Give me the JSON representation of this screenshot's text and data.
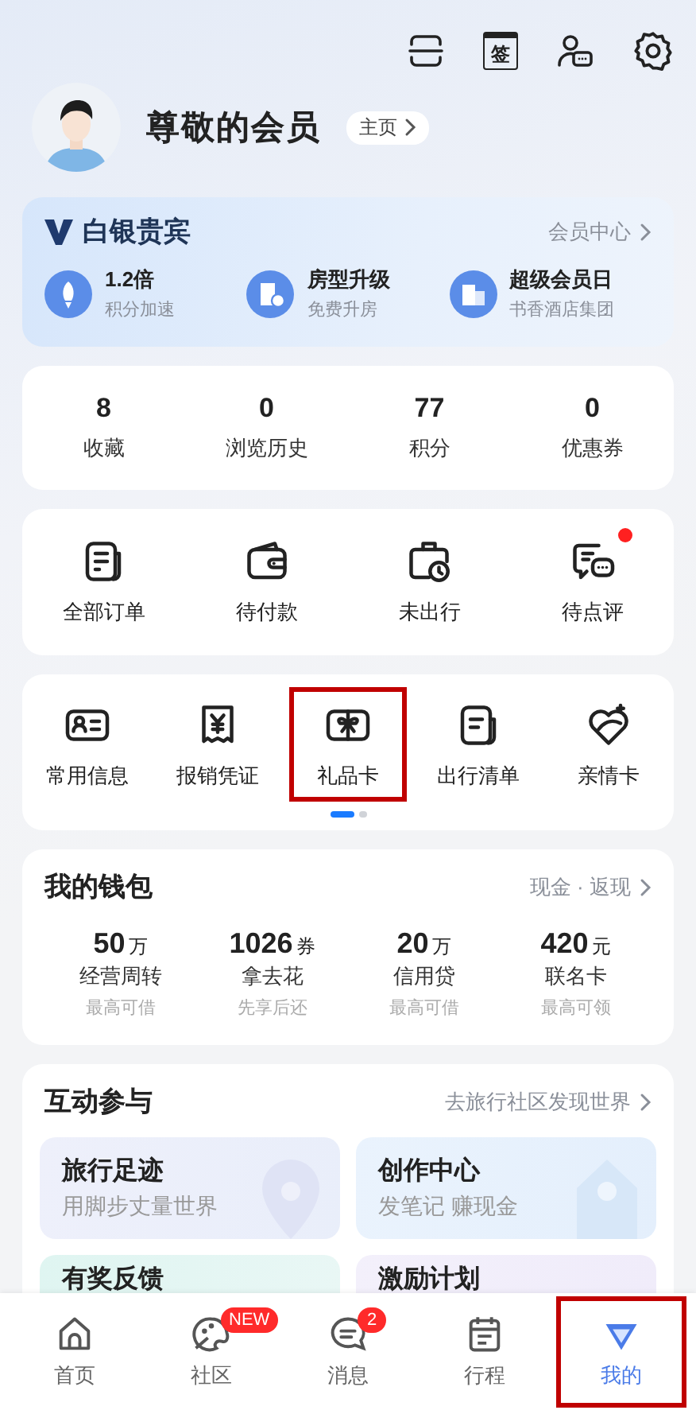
{
  "header": {
    "checkin_label": "签"
  },
  "profile": {
    "name": "尊敬的会员",
    "home_link": "主页"
  },
  "membership": {
    "tier": "白银贵宾",
    "center_link": "会员中心",
    "benefits": [
      {
        "title": "1.2倍",
        "subtitle": "积分加速"
      },
      {
        "title": "房型升级",
        "subtitle": "免费升房"
      },
      {
        "title": "超级会员日",
        "subtitle": "书香酒店集团"
      }
    ]
  },
  "stats": [
    {
      "value": "8",
      "label": "收藏"
    },
    {
      "value": "0",
      "label": "浏览历史"
    },
    {
      "value": "77",
      "label": "积分"
    },
    {
      "value": "0",
      "label": "优惠券"
    }
  ],
  "orders": [
    {
      "label": "全部订单",
      "dot": false
    },
    {
      "label": "待付款",
      "dot": false
    },
    {
      "label": "未出行",
      "dot": false
    },
    {
      "label": "待点评",
      "dot": true
    }
  ],
  "tools": [
    {
      "label": "常用信息",
      "highlighted": false
    },
    {
      "label": "报销凭证",
      "highlighted": false
    },
    {
      "label": "礼品卡",
      "highlighted": true
    },
    {
      "label": "出行清单",
      "highlighted": false
    },
    {
      "label": "亲情卡",
      "highlighted": false
    }
  ],
  "tools_pages": [
    {
      "selected": true
    },
    {
      "selected": false
    }
  ],
  "wallet": {
    "title": "我的钱包",
    "link": "现金 · 返现",
    "items": [
      {
        "amount": "50",
        "unit": "万",
        "label": "经营周转",
        "note": "最高可借"
      },
      {
        "amount": "1026",
        "unit": "券",
        "label": "拿去花",
        "note": "先享后还"
      },
      {
        "amount": "20",
        "unit": "万",
        "label": "信用贷",
        "note": "最高可借"
      },
      {
        "amount": "420",
        "unit": "元",
        "label": "联名卡",
        "note": "最高可领"
      }
    ]
  },
  "interact": {
    "title": "互动参与",
    "link": "去旅行社区发现世界",
    "cards": [
      {
        "title": "旅行足迹",
        "subtitle": "用脚步丈量世界"
      },
      {
        "title": "创作中心",
        "subtitle": "发笔记 赚现金"
      },
      {
        "title": "有奖反馈"
      },
      {
        "title": "激励计划"
      }
    ]
  },
  "tab_bar": [
    {
      "label": "首页",
      "selected": false,
      "highlighted": false
    },
    {
      "label": "社区",
      "badge": "NEW",
      "selected": false,
      "highlighted": false
    },
    {
      "label": "消息",
      "badge": "2",
      "selected": false,
      "highlighted": false
    },
    {
      "label": "行程",
      "selected": false,
      "highlighted": false
    },
    {
      "label": "我的",
      "selected": true,
      "highlighted": true
    }
  ]
}
